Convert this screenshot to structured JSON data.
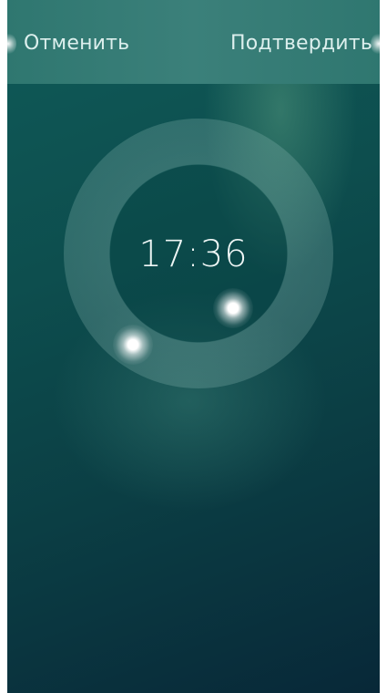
{
  "header": {
    "cancel_label": "Отменить",
    "confirm_label": "Подтвердить"
  },
  "time_picker": {
    "time": "17:36",
    "hour": 17,
    "minute": 36
  },
  "colors": {
    "background_top": "#0f5a58",
    "background_bottom": "#082838",
    "header_bar": "#3b807a",
    "text": "#dcefed",
    "handle": "#ffffff"
  }
}
